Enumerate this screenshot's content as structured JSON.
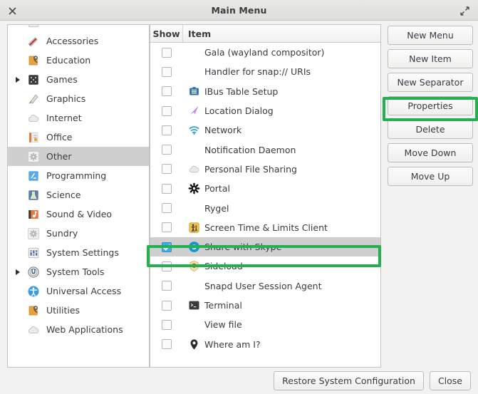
{
  "window": {
    "title": "Main Menu",
    "close_icon": "close-icon",
    "maximize_icon": "maximize-icon"
  },
  "sidebar": {
    "items": [
      {
        "label": "Accessories",
        "icon": "accessories-icon",
        "expander": false,
        "selected": false
      },
      {
        "label": "Education",
        "icon": "education-icon",
        "expander": false,
        "selected": false
      },
      {
        "label": "Games",
        "icon": "games-icon",
        "expander": true,
        "selected": false
      },
      {
        "label": "Graphics",
        "icon": "graphics-icon",
        "expander": false,
        "selected": false
      },
      {
        "label": "Internet",
        "icon": "internet-icon",
        "expander": false,
        "selected": false
      },
      {
        "label": "Office",
        "icon": "office-icon",
        "expander": false,
        "selected": false
      },
      {
        "label": "Other",
        "icon": "other-gear-icon",
        "expander": false,
        "selected": true
      },
      {
        "label": "Programming",
        "icon": "programming-icon",
        "expander": false,
        "selected": false
      },
      {
        "label": "Science",
        "icon": "science-icon",
        "expander": false,
        "selected": false
      },
      {
        "label": "Sound & Video",
        "icon": "sound-video-icon",
        "expander": false,
        "selected": false
      },
      {
        "label": "Sundry",
        "icon": "sundry-gear-icon",
        "expander": false,
        "selected": false
      },
      {
        "label": "System Settings",
        "icon": "system-settings-icon",
        "expander": false,
        "selected": false
      },
      {
        "label": "System Tools",
        "icon": "system-tools-icon",
        "expander": true,
        "selected": false
      },
      {
        "label": "Universal Access",
        "icon": "universal-access-icon",
        "expander": false,
        "selected": false
      },
      {
        "label": "Utilities",
        "icon": "utilities-icon",
        "expander": false,
        "selected": false
      },
      {
        "label": "Web Applications",
        "icon": "web-applications-icon",
        "expander": false,
        "selected": false
      }
    ]
  },
  "item_list": {
    "columns": [
      "Show",
      "Item"
    ],
    "rows": [
      {
        "label": "Gala (wayland compositor)",
        "icon": "",
        "checked": false,
        "selected": false
      },
      {
        "label": "Handler for snap:// URIs",
        "icon": "",
        "checked": false,
        "selected": false
      },
      {
        "label": "IBus Table Setup",
        "icon": "ibus-table-icon",
        "checked": false,
        "selected": false
      },
      {
        "label": "Location Dialog",
        "icon": "location-arrow-icon",
        "checked": false,
        "selected": false
      },
      {
        "label": "Network",
        "icon": "network-wifi-icon",
        "checked": false,
        "selected": false
      },
      {
        "label": "Notification Daemon",
        "icon": "",
        "checked": false,
        "selected": false
      },
      {
        "label": "Personal File Sharing",
        "icon": "cloud-icon",
        "checked": false,
        "selected": false
      },
      {
        "label": "Portal",
        "icon": "portal-gear-icon",
        "checked": false,
        "selected": false
      },
      {
        "label": "Rygel",
        "icon": "",
        "checked": false,
        "selected": false
      },
      {
        "label": "Screen Time & Limits Client",
        "icon": "screen-time-icon",
        "checked": false,
        "selected": false
      },
      {
        "label": "Share with Skype",
        "icon": "skype-icon",
        "checked": true,
        "selected": true
      },
      {
        "label": "Sideload",
        "icon": "sideload-shield-icon",
        "checked": false,
        "selected": false
      },
      {
        "label": "Snapd User Session Agent",
        "icon": "",
        "checked": false,
        "selected": false
      },
      {
        "label": "Terminal",
        "icon": "terminal-icon",
        "checked": false,
        "selected": false
      },
      {
        "label": "View file",
        "icon": "",
        "checked": false,
        "selected": false
      },
      {
        "label": "Where am I?",
        "icon": "map-pin-icon",
        "checked": false,
        "selected": false
      }
    ]
  },
  "action_buttons": [
    {
      "label": "New Menu",
      "highlighted": false
    },
    {
      "label": "New Item",
      "highlighted": false
    },
    {
      "label": "New Separator",
      "highlighted": false
    },
    {
      "label": "Properties",
      "highlighted": true
    },
    {
      "label": "Delete",
      "highlighted": false
    },
    {
      "label": "Move Down",
      "highlighted": false
    },
    {
      "label": "Move Up",
      "highlighted": false
    }
  ],
  "bottom_bar": {
    "restore_label": "Restore System Configuration",
    "close_label": "Close"
  },
  "annotations": {
    "color": "#22b14c",
    "targets": [
      "Properties",
      "Share with Skype"
    ]
  }
}
